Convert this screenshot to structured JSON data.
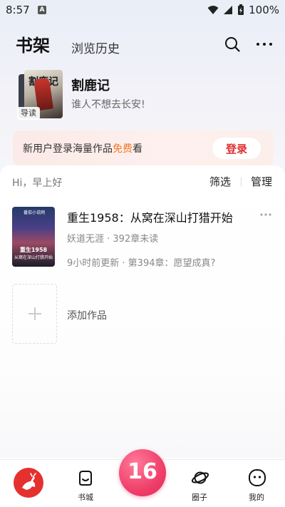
{
  "status_bar": {
    "time": "8:57",
    "notification_icon_letter": "A",
    "battery": "100%"
  },
  "header": {
    "tab_bookshelf": "书架",
    "tab_history": "浏览历史"
  },
  "featured": {
    "title": "割鹿记",
    "description": "谁人不想去长安!",
    "tag": "导读",
    "cover_text": "割鹿记"
  },
  "login_banner": {
    "text_before": "新用户登录海量作品",
    "text_free": "免费",
    "text_after": "看",
    "button": "登录",
    "free_color": "#f07a2c"
  },
  "shelf": {
    "greeting": "Hi，早上好",
    "filter": "筛选",
    "manage": "管理",
    "books": [
      {
        "title": "重生1958：从窝在深山打猎开始",
        "meta": "妖道无涯 · 392章未读",
        "update": "9小时前更新 · 第394章：愿望成真?",
        "cover_badge": "番茄小说网",
        "cover_line1": "重生1958",
        "cover_line2": "从窝在深山打猎开始"
      }
    ],
    "add_label": "添加作品"
  },
  "bottom_nav": {
    "items": [
      {
        "label": "书城",
        "icon": "bookstore-icon"
      },
      {
        "label": "圈子",
        "icon": "planet-icon"
      },
      {
        "label": "我的",
        "icon": "profile-face-icon"
      }
    ],
    "center_label": "16"
  },
  "colors": {
    "accent": "#e02e2e",
    "fab": "#f0406a"
  }
}
